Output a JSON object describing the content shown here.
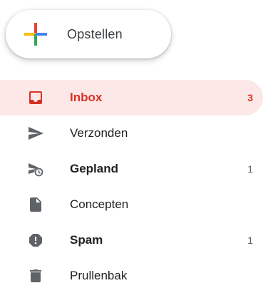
{
  "compose": {
    "label": "Opstellen",
    "icon": "plus-icon",
    "colors": [
      "#ea4335",
      "#fbbc04",
      "#34a853",
      "#4285f4"
    ]
  },
  "nav": {
    "items": [
      {
        "label": "Inbox",
        "count": "3",
        "icon": "inbox-icon",
        "active": true,
        "bold": true
      },
      {
        "label": "Verzonden",
        "count": "",
        "icon": "send-icon",
        "active": false,
        "bold": false
      },
      {
        "label": "Gepland",
        "count": "1",
        "icon": "scheduled-send-icon",
        "active": false,
        "bold": true
      },
      {
        "label": "Concepten",
        "count": "",
        "icon": "draft-icon",
        "active": false,
        "bold": false
      },
      {
        "label": "Spam",
        "count": "1",
        "icon": "spam-icon",
        "active": false,
        "bold": true
      },
      {
        "label": "Prullenbak",
        "count": "",
        "icon": "trash-icon",
        "active": false,
        "bold": false
      }
    ]
  },
  "colors": {
    "active_red": "#d93025",
    "active_bg": "#fce8e6",
    "icon_grey": "#5f6368"
  }
}
